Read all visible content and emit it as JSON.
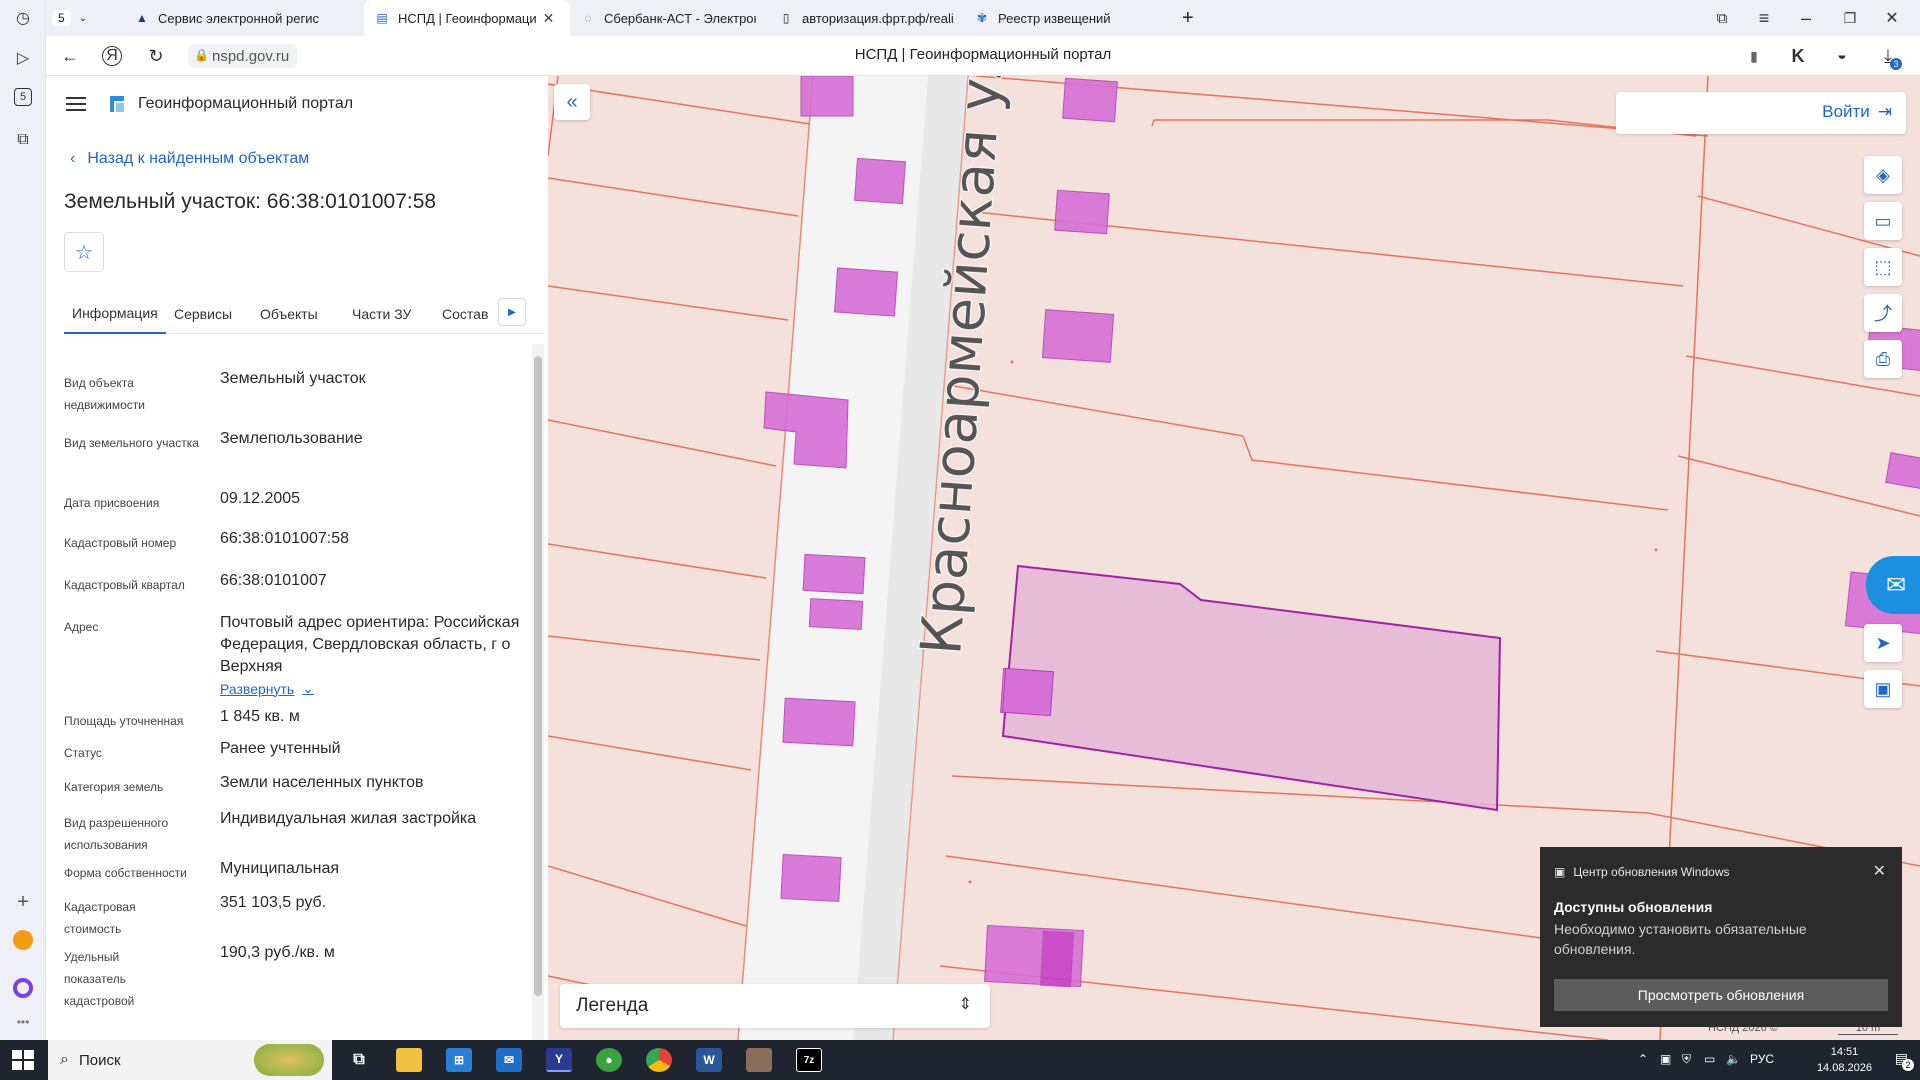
{
  "browser": {
    "tab_counter": "5",
    "tabs": [
      {
        "title": "Сервис электронной регис",
        "active": false
      },
      {
        "title": "НСПД | Геоинформаци",
        "active": true
      },
      {
        "title": "Сбербанк-АСТ - Электрон",
        "active": false
      },
      {
        "title": "авторизация.фрт.рф/reali",
        "active": false
      },
      {
        "title": "Реестр извещений",
        "active": false
      }
    ],
    "new_tab": "+",
    "url": "nspd.gov.ru",
    "page_title": "НСПД | Геоинформационный портал",
    "downloads_badge": "3"
  },
  "panel": {
    "portal_name": "Геоинформационный портал",
    "back_label": "Назад к найденным объектам",
    "object_title": "Земельный участок: 66:38:0101007:58",
    "tabs": [
      "Информация",
      "Сервисы",
      "Объекты",
      "Части ЗУ",
      "Состав"
    ],
    "fields": [
      {
        "label": "Вид объекта недвижимости",
        "value": "Земельный участок"
      },
      {
        "label": "Вид земельного участка",
        "value": "Землепользование"
      },
      {
        "label": "Дата присвоения",
        "value": "09.12.2005"
      },
      {
        "label": "Кадастровый номер",
        "value": "66:38:0101007:58"
      },
      {
        "label": "Кадастровый квартал",
        "value": "66:38:0101007"
      },
      {
        "label": "Адрес",
        "value": "Почтовый адрес ориентира: Российская Федерация, Свердловская область, г о Верхняя"
      },
      {
        "label": "Площадь уточненная",
        "value": "1 845 кв. м"
      },
      {
        "label": "Статус",
        "value": "Ранее учтенный"
      },
      {
        "label": "Категория земель",
        "value": "Земли населенных пунктов"
      },
      {
        "label": "Вид разрешенного использования",
        "value": "Индивидуальная жилая застройка"
      },
      {
        "label": "Форма собственности",
        "value": "Муниципальная"
      },
      {
        "label": "Кадастровая стоимость",
        "value": "351 103,5 руб."
      },
      {
        "label": "Удельный показатель кадастровой",
        "value": "190,3 руб./кв. м"
      }
    ],
    "expand_label": "Развернуть"
  },
  "map": {
    "street_label": "Красноармейская ул",
    "login_label": "Войти",
    "legend_label": "Легенда",
    "copyright": "НСПД 2026 ©",
    "scale_label": "10 m",
    "parcel_color": "#a320a8"
  },
  "toast": {
    "app": "Центр обновления Windows",
    "title": "Доступны обновления",
    "text": "Необходимо установить обязательные обновления.",
    "button": "Просмотреть обновления"
  },
  "taskbar": {
    "search": "Поиск",
    "lang": "РУС",
    "time": "14:51",
    "date": "14.08.2026",
    "notif_count": "2"
  }
}
